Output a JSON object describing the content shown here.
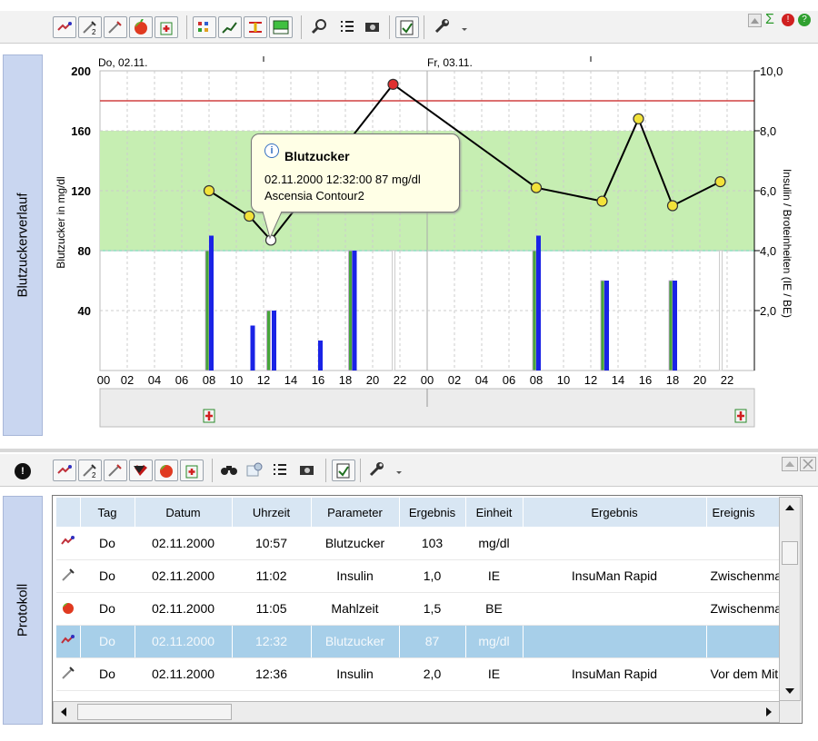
{
  "top_toolbar": {
    "items": [
      "glucose-icon",
      "insulin2-icon",
      "insulin-icon",
      "apple-icon",
      "medkit-icon",
      "grid-icon",
      "trend-icon",
      "range-icon",
      "area-icon",
      "zoom-icon",
      "list-icon",
      "camera-icon",
      "export-icon",
      "wrench-icon"
    ]
  },
  "chart": {
    "side_label": "Blutzuckerverlauf",
    "day1": "Do, 02.11.",
    "day2": "Fr, 03.11.",
    "left_axis_label": "Blutzucker in mg/dl",
    "right_axis_label": "Insulin / Broteinheiten (IE / BE)",
    "left_ticks": [
      "200",
      "160",
      "120",
      "80",
      "40"
    ],
    "right_ticks": [
      "10,0",
      "8,0",
      "6,0",
      "4,0",
      "2,0"
    ],
    "x_ticks": [
      "00",
      "02",
      "04",
      "06",
      "08",
      "10",
      "12",
      "14",
      "16",
      "18",
      "20",
      "22",
      "00",
      "02",
      "04",
      "06",
      "08",
      "10",
      "12",
      "14",
      "16",
      "18",
      "20",
      "22"
    ],
    "colors": {
      "target": "#c6eeb2",
      "line": "#000000",
      "limit": "#d04040",
      "point": "#f2e23a",
      "insulin": "#1a23e6",
      "carbs": "#46a63a"
    }
  },
  "chart_data": {
    "type": "line",
    "xlabel": "",
    "ylabel": "Blutzucker in mg/dl",
    "y2label": "Insulin / Broteinheiten (IE / BE)",
    "ylim": [
      0,
      200
    ],
    "y2lim": [
      0,
      10
    ],
    "target_range": [
      80,
      160
    ],
    "upper_limit": 180,
    "series": [
      {
        "values_x": [
          "02.11. 08:00",
          "02.11. 10:57",
          "02.11. 12:32",
          "02.11. 21:30",
          "03.11. 08:00",
          "03.11. 12:50",
          "03.11. 15:30",
          "03.11. 18:00",
          "03.11. 21:30"
        ],
        "values": [
          120,
          103,
          87,
          191,
          122,
          113,
          168,
          110,
          126
        ]
      }
    ],
    "insulin_bars": [
      {
        "x": "02.11. 08:00",
        "y": 4.5
      },
      {
        "x": "02.11. 11:02",
        "y": 1.5
      },
      {
        "x": "02.11. 12:36",
        "y": 2.0
      },
      {
        "x": "02.11. 16:00",
        "y": 1.0
      },
      {
        "x": "02.11. 18:30",
        "y": 4.0
      },
      {
        "x": "03.11. 08:00",
        "y": 4.5
      },
      {
        "x": "03.11. 13:00",
        "y": 3.0
      },
      {
        "x": "03.11. 18:00",
        "y": 3.0
      }
    ],
    "carb_bars": [
      {
        "x": "02.11. 08:00",
        "y": 4.0
      },
      {
        "x": "02.11. 12:30",
        "y": 2.0
      },
      {
        "x": "02.11. 18:30",
        "y": 4.0
      },
      {
        "x": "03.11. 08:00",
        "y": 4.0
      },
      {
        "x": "03.11. 13:00",
        "y": 3.0
      },
      {
        "x": "03.11. 18:00",
        "y": 3.0
      }
    ]
  },
  "tooltip": {
    "title": "Blutzucker",
    "line1": "02.11.2000 12:32:00 87 mg/dl",
    "line2": "Ascensia Contour2"
  },
  "protocol": {
    "side_label": "Protokoll",
    "columns": [
      "Tag",
      "Datum",
      "Uhrzeit",
      "Parameter",
      "Ergebnis",
      "Einheit",
      "Ergebnis",
      "Ereignis"
    ],
    "rows": [
      {
        "icon": "glucose-icon",
        "tag": "Do",
        "datum": "02.11.2000",
        "uhrzeit": "10:57",
        "parameter": "Blutzucker",
        "ergebnis": "103",
        "einheit": "mg/dl",
        "ergebnis2": "",
        "ereignis": ""
      },
      {
        "icon": "syringe-icon",
        "tag": "Do",
        "datum": "02.11.2000",
        "uhrzeit": "11:02",
        "parameter": "Insulin",
        "ergebnis": "1,0",
        "einheit": "IE",
        "ergebnis2": "InsuMan Rapid",
        "ereignis": "Zwischenma"
      },
      {
        "icon": "apple-icon",
        "tag": "Do",
        "datum": "02.11.2000",
        "uhrzeit": "11:05",
        "parameter": "Mahlzeit",
        "ergebnis": "1,5",
        "einheit": "BE",
        "ergebnis2": "",
        "ereignis": "Zwischenma"
      },
      {
        "icon": "glucose-icon",
        "tag": "Do",
        "datum": "02.11.2000",
        "uhrzeit": "12:32",
        "parameter": "Blutzucker",
        "ergebnis": "87",
        "einheit": "mg/dl",
        "ergebnis2": "",
        "ereignis": "",
        "selected": true
      },
      {
        "icon": "syringe-icon",
        "tag": "Do",
        "datum": "02.11.2000",
        "uhrzeit": "12:36",
        "parameter": "Insulin",
        "ergebnis": "2,0",
        "einheit": "IE",
        "ergebnis2": "InsuMan Rapid",
        "ereignis": "Vor dem Mit"
      }
    ]
  }
}
